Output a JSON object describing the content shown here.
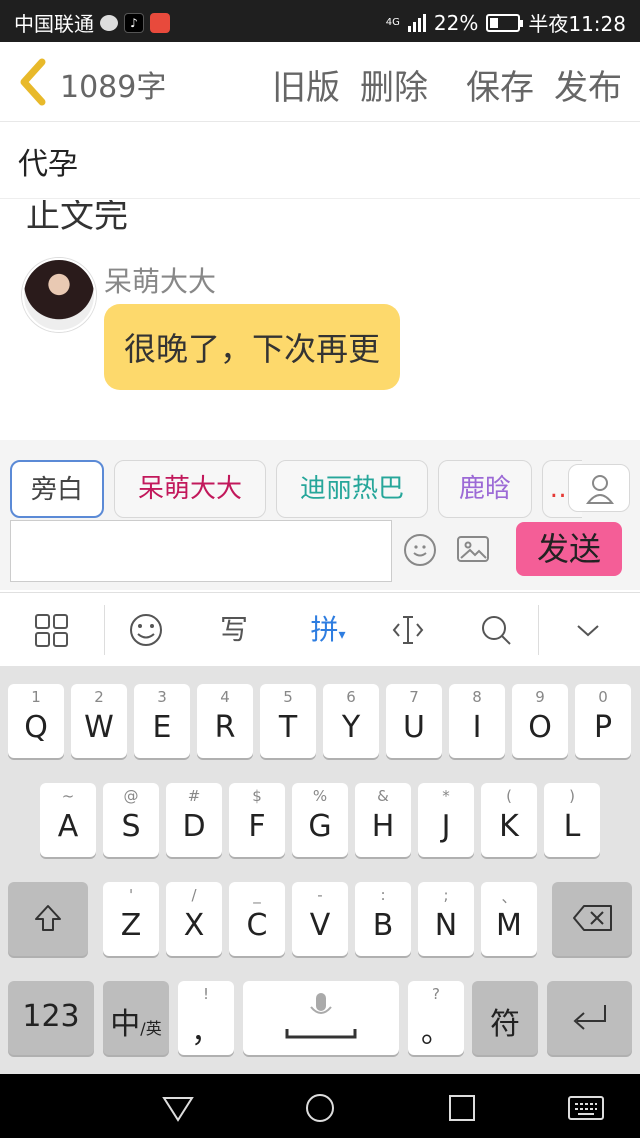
{
  "status_bar": {
    "carrier": "中国联通",
    "network": "4G",
    "battery": "22%",
    "time": "半夜11:28"
  },
  "header": {
    "word_count": "1089字",
    "old_version": "旧版",
    "delete": "删除",
    "save": "保存",
    "publish": "发布"
  },
  "title": "代孕",
  "content": {
    "partial_text": "止文完",
    "speaker": "呆萌大大",
    "message": "很晚了，下次再更"
  },
  "chips": [
    {
      "label": "旁白",
      "color": "#444444"
    },
    {
      "label": "呆萌大大",
      "color": "#c2185b"
    },
    {
      "label": "迪丽热巴",
      "color": "#26a69a"
    },
    {
      "label": "鹿晗",
      "color": "#9c6ad6"
    }
  ],
  "input": {
    "value": "",
    "send": "发送"
  },
  "ime": {
    "pinyin": "拼",
    "write": "写"
  },
  "keyboard": {
    "row1": [
      {
        "sub": "1",
        "key": "Q"
      },
      {
        "sub": "2",
        "key": "W"
      },
      {
        "sub": "3",
        "key": "E"
      },
      {
        "sub": "4",
        "key": "R"
      },
      {
        "sub": "5",
        "key": "T"
      },
      {
        "sub": "6",
        "key": "Y"
      },
      {
        "sub": "7",
        "key": "U"
      },
      {
        "sub": "8",
        "key": "I"
      },
      {
        "sub": "9",
        "key": "O"
      },
      {
        "sub": "0",
        "key": "P"
      }
    ],
    "row2": [
      {
        "sub": "~",
        "key": "A"
      },
      {
        "sub": "@",
        "key": "S"
      },
      {
        "sub": "#",
        "key": "D"
      },
      {
        "sub": "$",
        "key": "F"
      },
      {
        "sub": "%",
        "key": "G"
      },
      {
        "sub": "&",
        "key": "H"
      },
      {
        "sub": "*",
        "key": "J"
      },
      {
        "sub": "(",
        "key": "K"
      },
      {
        "sub": ")",
        "key": "L"
      }
    ],
    "row3": [
      {
        "sub": "'",
        "key": "Z"
      },
      {
        "sub": "/",
        "key": "X"
      },
      {
        "sub": "_",
        "key": "C"
      },
      {
        "sub": "-",
        "key": "V"
      },
      {
        "sub": ":",
        "key": "B"
      },
      {
        "sub": ";",
        "key": "N"
      },
      {
        "sub": "、",
        "key": "M"
      }
    ],
    "num_key": "123",
    "lang_key": "中",
    "lang_sub": "/英",
    "comma_sub": "!",
    "comma_key": "，",
    "period_sub": "?",
    "period_key": "。",
    "symbol_key": "符"
  },
  "colors": {
    "bubble": "#fdd96c",
    "send": "#f45e97",
    "accent_blue": "#2e7de0",
    "back_arrow": "#e8b92a"
  }
}
